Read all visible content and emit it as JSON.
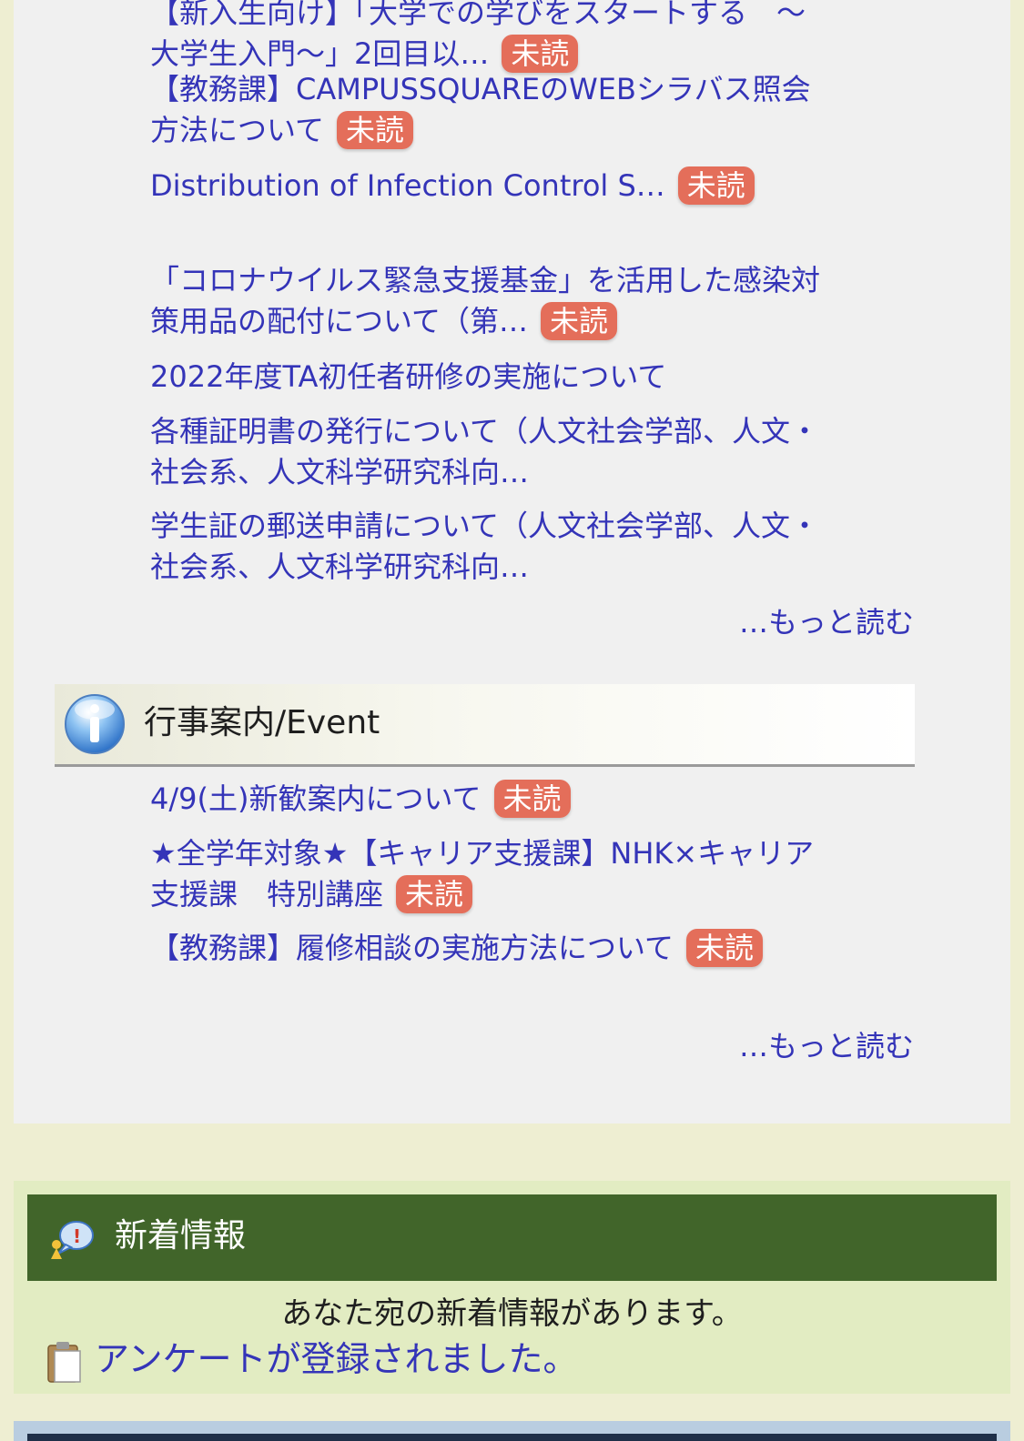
{
  "notices": [
    {
      "text": "【新入生向け】「大学での学びをスタートする　〜大学生入門〜」2回目以…",
      "unread": true
    },
    {
      "text": "【教務課】CAMPUSSQUAREのWEBシラバス照会方法について",
      "unread": true
    },
    {
      "text": "Distribution of Infection Control S…",
      "unread": true
    },
    {
      "text": "「コロナウイルス緊急支援基金」を活用した感染対策用品の配付について（第…",
      "unread": true
    },
    {
      "text": "2022年度TA初任者研修の実施について",
      "unread": false
    },
    {
      "text": "各種証明書の発行について（人文社会学部、人文・社会系、人文科学研究科向…",
      "unread": false
    },
    {
      "text": "学生証の郵送申請について（人文社会学部、人文・社会系、人文科学研究科向…",
      "unread": false
    }
  ],
  "read_more_label": "…もっと読む",
  "unread_label": "未読",
  "event_section": {
    "icon": "info-icon",
    "title": "行事案内/Event",
    "items": [
      {
        "text": "4/9(土)新歓案内について",
        "unread": true
      },
      {
        "text": "★全学年対象★【キャリア支援課】NHK×キャリア支援課　特別講座",
        "unread": true
      },
      {
        "text": "【教務課】履修相談の実施方法について",
        "unread": true
      }
    ],
    "read_more_label": "…もっと読む"
  },
  "news_section": {
    "icon": "new-info-icon",
    "title": "新着情報",
    "message": "あなた宛の新着情報があります。",
    "link_icon": "clipboard-icon",
    "link_text": "アンケートが登録されました。"
  },
  "colors": {
    "link": "#3434b8",
    "badge": "#e46e5a",
    "news_header": "#41652a"
  }
}
